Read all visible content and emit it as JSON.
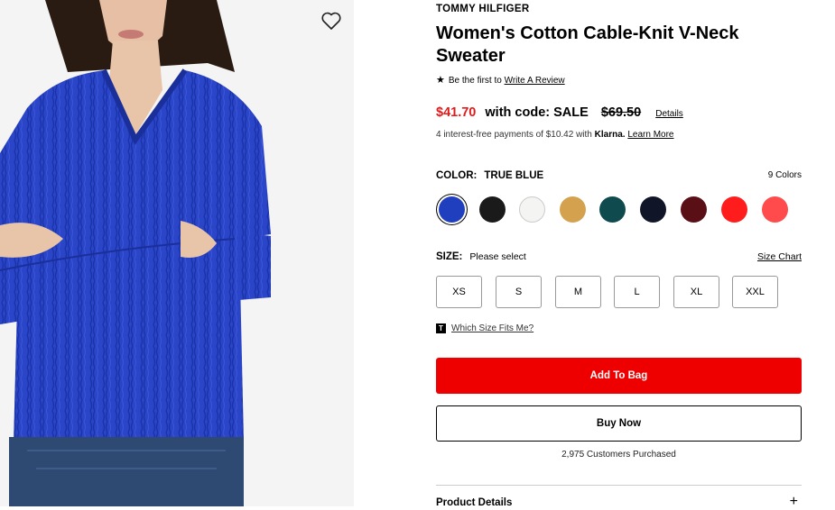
{
  "product": {
    "brand": "TOMMY HILFIGER",
    "title": "Women's Cotton Cable-Knit V-Neck Sweater",
    "image_alt": "Woman wearing blue cable-knit v-neck sweater"
  },
  "review": {
    "prefix": "Be the first to",
    "link": "Write A Review"
  },
  "price": {
    "sale": "$41.70",
    "code_text": "with code: SALE",
    "original": "$69.50",
    "details_link": "Details"
  },
  "klarna": {
    "text": "4 interest-free payments of $10.42 with",
    "brand": "Klarna.",
    "link": "Learn More"
  },
  "color": {
    "label": "COLOR:",
    "selected": "TRUE BLUE",
    "count": "9 Colors",
    "swatches": [
      {
        "name": "True Blue",
        "hex": "#1f3fbf",
        "selected": true
      },
      {
        "name": "Black",
        "hex": "#1a1a1a"
      },
      {
        "name": "White",
        "hex": "#f4f4f2"
      },
      {
        "name": "Camel",
        "hex": "#d4a24f"
      },
      {
        "name": "Teal",
        "hex": "#0f4a4f"
      },
      {
        "name": "Navy",
        "hex": "#101628"
      },
      {
        "name": "Burgundy",
        "hex": "#5a0f16"
      },
      {
        "name": "Red",
        "hex": "#ff1c1c"
      },
      {
        "name": "Coral",
        "hex": "#ff4b4b"
      }
    ]
  },
  "size": {
    "label": "SIZE:",
    "prompt": "Please select",
    "chart_link": "Size Chart",
    "options": [
      "XS",
      "S",
      "M",
      "L",
      "XL",
      "XXL"
    ],
    "fit_icon": "T",
    "fit_link": "Which Size Fits Me?"
  },
  "actions": {
    "add_to_bag": "Add To Bag",
    "buy_now": "Buy Now",
    "purchased": "2,975 Customers Purchased"
  },
  "accordion": {
    "product_details": "Product Details",
    "expand_icon": "+"
  },
  "colors": {
    "sale_red": "#e11a1a",
    "cta_red": "#ee0000"
  }
}
